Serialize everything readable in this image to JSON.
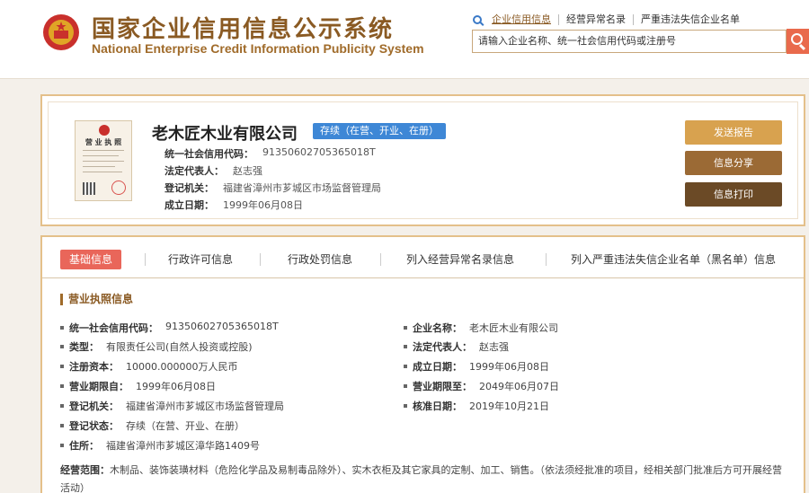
{
  "header": {
    "title_cn": "国家企业信用信息公示系统",
    "title_en": "National Enterprise Credit Information Publicity System",
    "nav": [
      "企业信用信息",
      "经营异常名录",
      "严重违法失信企业名单"
    ],
    "search_placeholder": "请输入企业名称、统一社会信用代码或注册号",
    "accent_color": "#8a5a23"
  },
  "company": {
    "name": "老木匠木业有限公司",
    "status": "存续（在营、开业、在册）",
    "license_title": "营 业 执 照",
    "fields": [
      {
        "label": "统一社会信用代码：",
        "value": "91350602705365018T"
      },
      {
        "label": "法定代表人：",
        "value": "赵志强"
      },
      {
        "label": "登记机关：",
        "value": "福建省漳州市芗城区市场监督管理局"
      },
      {
        "label": "成立日期：",
        "value": "1999年06月08日"
      }
    ],
    "buttons": {
      "report": "发送报告",
      "share": "信息分享",
      "print": "信息打印"
    }
  },
  "tabs": [
    "基础信息",
    "行政许可信息",
    "行政处罚信息",
    "列入经营异常名录信息",
    "列入严重违法失信企业名单（黑名单）信息"
  ],
  "section_title": "营业执照信息",
  "details": {
    "left": [
      {
        "label": "统一社会信用代码：",
        "value": "91350602705365018T"
      },
      {
        "label": "类型：",
        "value": "有限责任公司(自然人投资或控股)"
      },
      {
        "label": "注册资本：",
        "value": "10000.000000万人民币"
      },
      {
        "label": "营业期限自：",
        "value": "1999年06月08日"
      },
      {
        "label": "登记机关：",
        "value": "福建省漳州市芗城区市场监督管理局"
      },
      {
        "label": "登记状态：",
        "value": "存续（在营、开业、在册）"
      },
      {
        "label": "住所：",
        "value": "福建省漳州市芗城区漳华路1409号"
      }
    ],
    "right": [
      {
        "label": "企业名称：",
        "value": "老木匠木业有限公司"
      },
      {
        "label": "法定代表人：",
        "value": "赵志强"
      },
      {
        "label": "成立日期：",
        "value": "1999年06月08日"
      },
      {
        "label": "营业期限至：",
        "value": "2049年06月07日"
      },
      {
        "label": "核准日期：",
        "value": "2019年10月21日"
      }
    ],
    "scope_label": "经营范围：",
    "scope_value": "木制品、装饰装璜材料（危险化学品及易制毒品除外）、实木衣柜及其它家具的定制、加工、销售。（依法须经批准的项目，经相关部门批准后方可开展经营活动）"
  }
}
